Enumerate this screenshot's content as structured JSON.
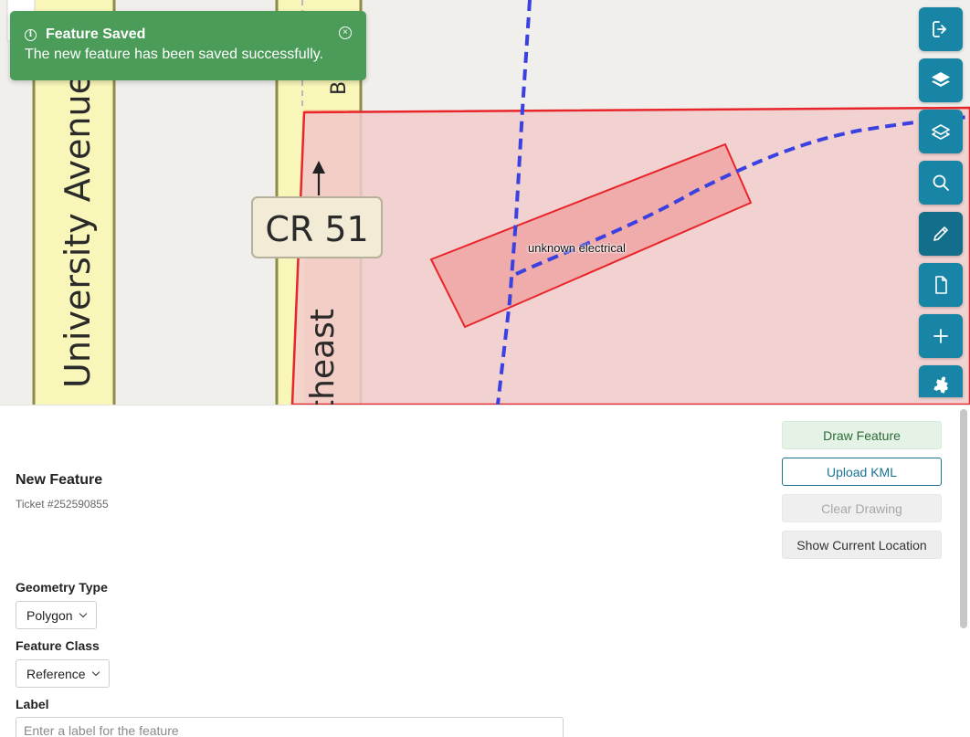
{
  "map": {
    "road_label_university": "University Avenue",
    "road_label_northeast": "theast",
    "road_label_partial": "B",
    "route_shield": "CR 51",
    "feature_label": "unknown electrical",
    "colors": {
      "polygon_stroke": "#e8252b",
      "polygon_fill": "#f2cccc",
      "feature_fill": "#f0a4a4",
      "dashed_line": "#3b40e0",
      "road_yellow": "#f8f6b8",
      "road_orange": "#f6d6a2"
    }
  },
  "toast": {
    "title": "Feature Saved",
    "message": "The new feature has been saved successfully.",
    "icon": "info-icon",
    "close_icon": "close-circle-icon",
    "color": "#4a9c58"
  },
  "toolbar": {
    "color": "#1985a6",
    "buttons": [
      {
        "icon": "logout-icon"
      },
      {
        "icon": "layers-icon"
      },
      {
        "icon": "layer-outline-icon"
      },
      {
        "icon": "search-icon"
      },
      {
        "icon": "pencil-icon"
      },
      {
        "icon": "document-icon"
      },
      {
        "icon": "plus-icon"
      },
      {
        "icon": "puzzle-icon"
      }
    ]
  },
  "panel": {
    "title": "New Feature",
    "ticket": "Ticket #252590855",
    "buttons": {
      "draw": "Draw Feature",
      "upload": "Upload KML",
      "clear": "Clear Drawing",
      "location": "Show Current Location"
    },
    "geometry_type": {
      "label": "Geometry Type",
      "value": "Polygon"
    },
    "feature_class": {
      "label": "Feature Class",
      "value": "Reference"
    },
    "label_field": {
      "label": "Label",
      "placeholder": "Enter a label for the feature",
      "value": ""
    }
  }
}
